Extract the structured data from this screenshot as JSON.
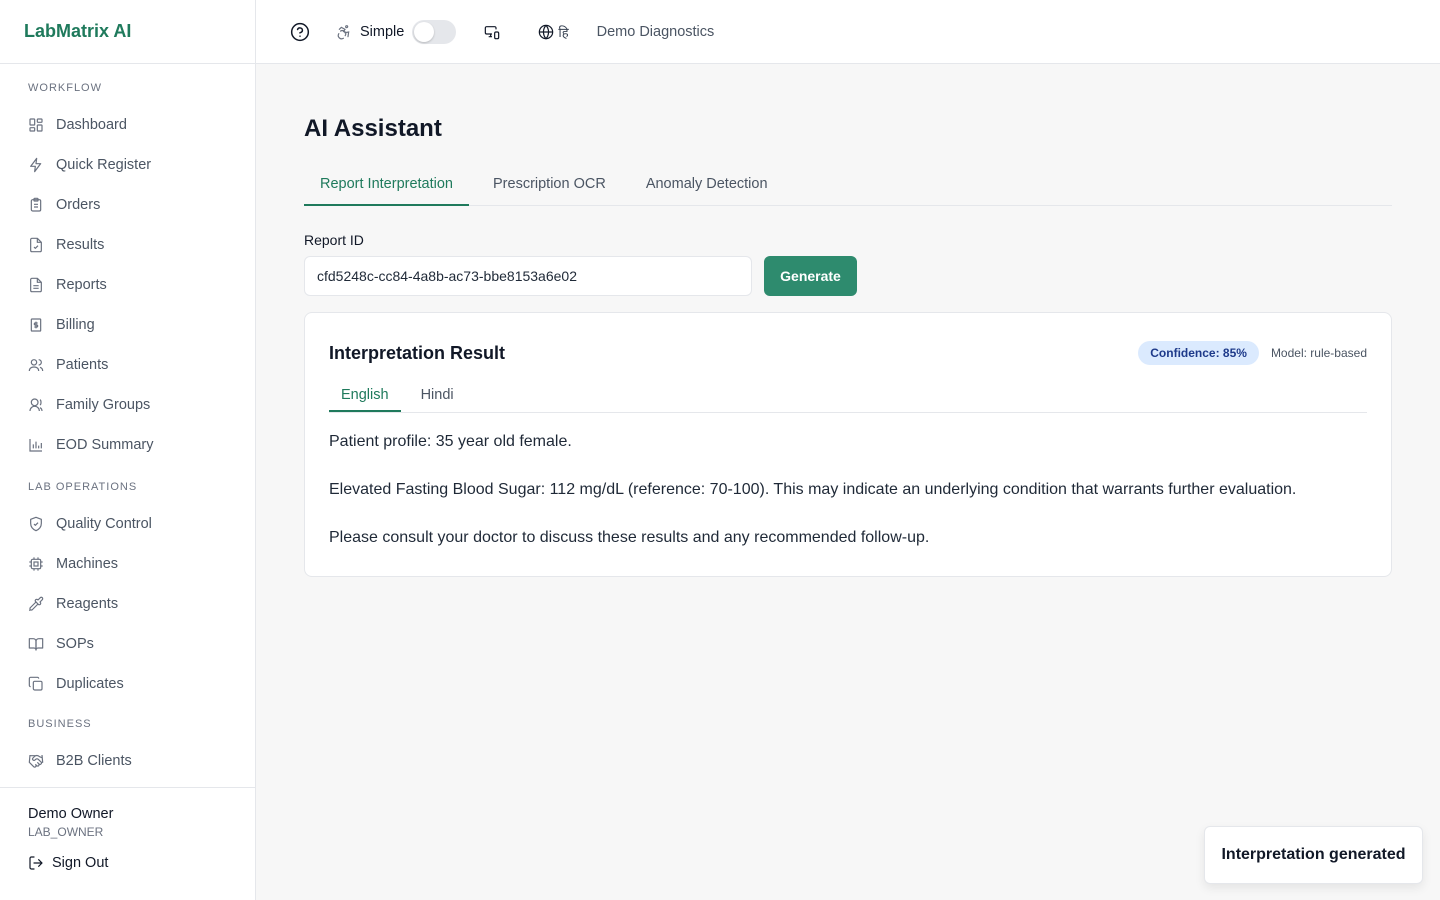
{
  "app": {
    "name": "LabMatrix AI"
  },
  "sidebar": {
    "sections": [
      {
        "title": "WORKFLOW",
        "items": [
          {
            "label": "Dashboard",
            "icon": "dashboard-icon"
          },
          {
            "label": "Quick Register",
            "icon": "lightning-icon"
          },
          {
            "label": "Orders",
            "icon": "clipboard-icon"
          },
          {
            "label": "Results",
            "icon": "file-check-icon"
          },
          {
            "label": "Reports",
            "icon": "file-text-icon"
          },
          {
            "label": "Billing",
            "icon": "receipt-icon"
          },
          {
            "label": "Patients",
            "icon": "users-icon"
          },
          {
            "label": "Family Groups",
            "icon": "user-group-icon"
          },
          {
            "label": "EOD Summary",
            "icon": "bar-chart-icon"
          }
        ]
      },
      {
        "title": "LAB OPERATIONS",
        "items": [
          {
            "label": "Quality Control",
            "icon": "shield-check-icon"
          },
          {
            "label": "Machines",
            "icon": "cpu-icon"
          },
          {
            "label": "Reagents",
            "icon": "pipette-icon"
          },
          {
            "label": "SOPs",
            "icon": "book-icon"
          },
          {
            "label": "Duplicates",
            "icon": "copy-icon"
          }
        ]
      },
      {
        "title": "BUSINESS",
        "items": [
          {
            "label": "B2B Clients",
            "icon": "handshake-icon"
          }
        ]
      }
    ],
    "user": {
      "name": "Demo Owner",
      "role": "LAB_OWNER",
      "signout_label": "Sign Out"
    }
  },
  "topbar": {
    "simple_label": "Simple",
    "simple_mode_on": false,
    "language_label": "हि",
    "org_name": "Demo Diagnostics"
  },
  "main": {
    "title": "AI Assistant",
    "tabs": [
      {
        "label": "Report Interpretation",
        "active": true
      },
      {
        "label": "Prescription OCR",
        "active": false
      },
      {
        "label": "Anomaly Detection",
        "active": false
      }
    ],
    "report_id_label": "Report ID",
    "report_id_value": "cfd5248c-cc84-4a8b-ac73-bbe8153a6e02",
    "generate_label": "Generate",
    "result": {
      "title": "Interpretation Result",
      "confidence": "Confidence: 85%",
      "model": "Model: rule-based",
      "lang_tabs": [
        {
          "label": "English",
          "active": true
        },
        {
          "label": "Hindi",
          "active": false
        }
      ],
      "paragraphs": [
        "Patient profile: 35 year old female.",
        "Elevated Fasting Blood Sugar: 112 mg/dL (reference: 70-100). This may indicate an underlying condition that warrants further evaluation.",
        "Please consult your doctor to discuss these results and any recommended follow-up."
      ]
    }
  },
  "toast": {
    "message": "Interpretation generated"
  },
  "colors": {
    "brand": "#1f7a5c",
    "primary_button": "#2e8b6e",
    "badge_bg": "#dbeafe",
    "badge_text": "#1e3a8a"
  }
}
